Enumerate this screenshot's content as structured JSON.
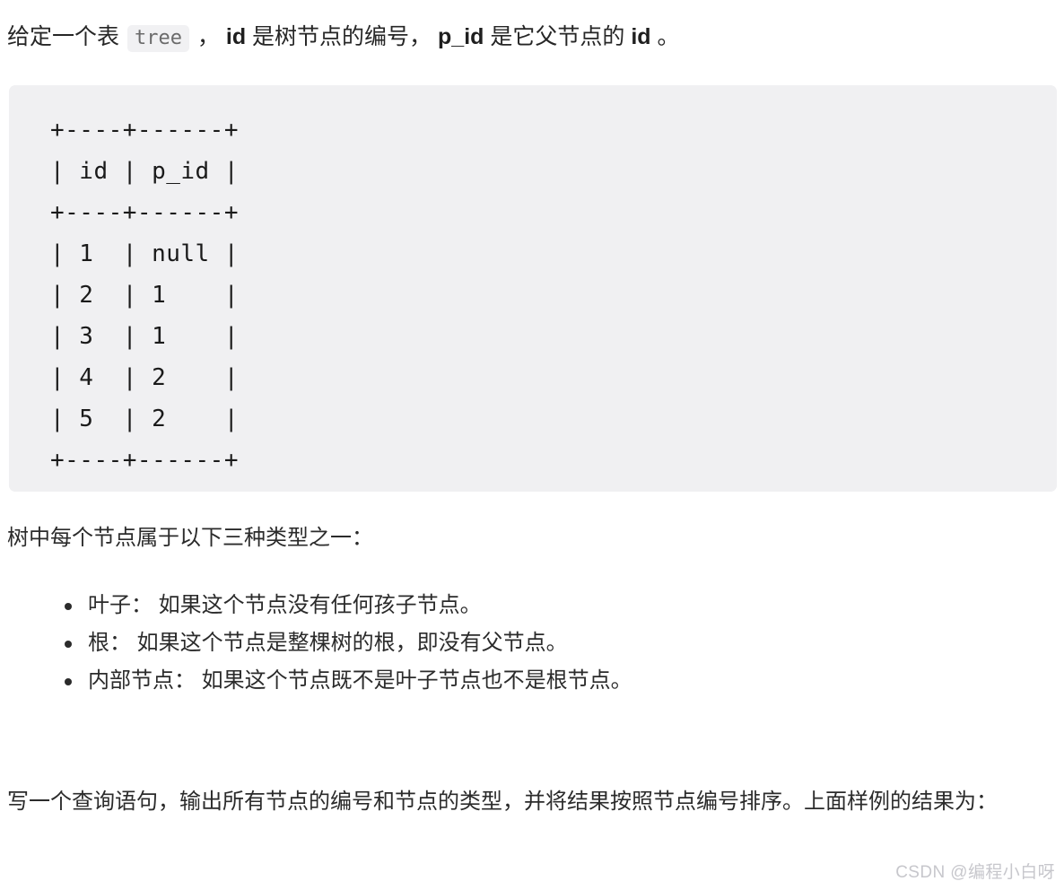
{
  "intro": {
    "part1": "给定一个表",
    "code": "tree",
    "part2": "，",
    "bold1": "id",
    "part3": "是树节点的编号，",
    "bold2": "p_id",
    "part4": "是它父节点的",
    "bold3": "id",
    "part5": "。"
  },
  "code_block": {
    "language": "text",
    "content": "+----+------+\n| id | p_id |\n+----+------+\n| 1  | null |\n| 2  | 1    |\n| 3  | 1    |\n| 4  | 2    |\n| 5  | 2    |\n+----+------+",
    "table": {
      "columns": [
        "id",
        "p_id"
      ],
      "rows": [
        [
          "1",
          "null"
        ],
        [
          "2",
          "1"
        ],
        [
          "3",
          "1"
        ],
        [
          "4",
          "2"
        ],
        [
          "5",
          "2"
        ]
      ]
    },
    "background_color": "#f0f0f2"
  },
  "types_intro": "树中每个节点属于以下三种类型之一：",
  "type_items": [
    "叶子： 如果这个节点没有任何孩子节点。",
    "根： 如果这个节点是整棵树的根，即没有父节点。",
    "内部节点： 如果这个节点既不是叶子节点也不是根节点。"
  ],
  "query_paragraph": "写一个查询语句，输出所有节点的编号和节点的类型，并将结果按照节点编号排序。上面样例的结果为：",
  "watermark": "CSDN @编程小白呀"
}
